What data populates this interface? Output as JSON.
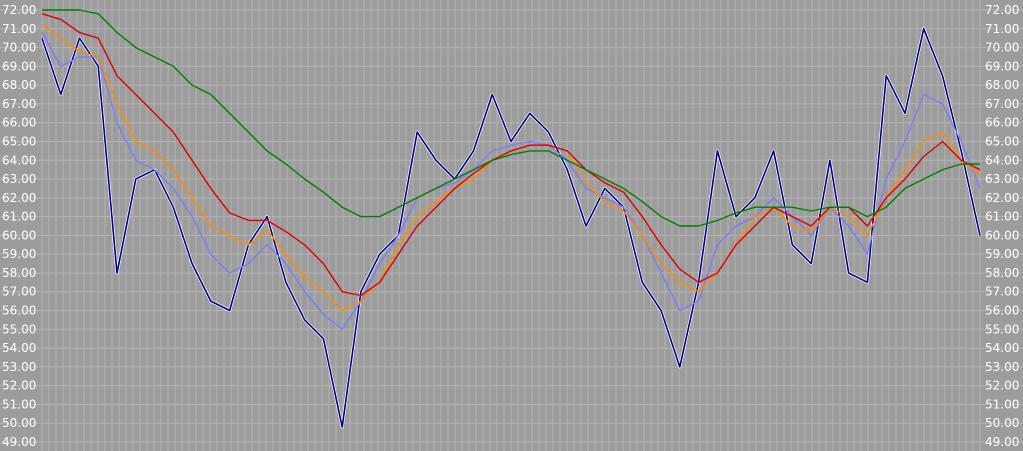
{
  "chart_data": {
    "type": "line",
    "title": "",
    "xlabel": "",
    "ylabel": "",
    "ylim": [
      49,
      72
    ],
    "grid": true,
    "y_ticks": [
      "72.00",
      "71.00",
      "70.00",
      "69.00",
      "68.00",
      "67.00",
      "66.00",
      "65.00",
      "64.00",
      "63.00",
      "62.00",
      "61.00",
      "60.00",
      "59.00",
      "58.00",
      "57.00",
      "56.00",
      "55.00",
      "54.00",
      "53.00",
      "52.00",
      "51.00",
      "50.00",
      "49.00"
    ],
    "y_tick_values": [
      72,
      71,
      70,
      69,
      68,
      67,
      66,
      65,
      64,
      63,
      62,
      61,
      60,
      59,
      58,
      57,
      56,
      55,
      54,
      53,
      52,
      51,
      50,
      49
    ],
    "x": [
      0,
      10,
      20,
      30,
      40,
      50,
      60,
      70,
      80,
      90,
      100,
      110,
      120,
      130,
      140,
      150,
      160,
      170,
      180,
      190,
      200,
      210,
      220,
      230,
      240,
      250,
      260,
      270,
      280,
      290,
      300,
      310,
      320,
      330,
      340,
      350,
      360,
      370,
      380,
      390,
      400,
      410,
      420,
      430,
      440,
      450,
      460,
      470,
      480,
      490,
      500
    ],
    "series": [
      {
        "color": "#000080",
        "values": [
          70.5,
          67.5,
          70.5,
          69.0,
          58.0,
          63.0,
          63.5,
          61.5,
          58.5,
          56.5,
          56.0,
          59.5,
          61.0,
          57.5,
          55.5,
          54.5,
          49.8,
          57.0,
          59.0,
          60.0,
          65.5,
          64.0,
          63.0,
          64.5,
          67.5,
          65.0,
          66.5,
          65.5,
          63.5,
          60.5,
          62.5,
          61.5,
          57.5,
          56.0,
          53.0,
          57.5,
          64.5,
          61.0,
          62.0,
          64.5,
          59.5,
          58.5,
          64.0,
          58.0,
          57.5,
          68.5,
          66.5,
          71.0,
          68.5,
          64.5,
          60.0
        ]
      },
      {
        "color": "#7c7cfc",
        "values": [
          70.8,
          69.0,
          69.5,
          69.5,
          66.0,
          64.0,
          63.5,
          62.5,
          61.0,
          59.0,
          58.0,
          58.5,
          59.5,
          58.5,
          57.0,
          55.8,
          55.0,
          56.5,
          58.5,
          60.0,
          62.0,
          62.5,
          62.8,
          63.5,
          64.5,
          64.8,
          65.0,
          64.8,
          64.0,
          62.5,
          62.0,
          61.5,
          60.0,
          58.0,
          56.0,
          56.5,
          59.5,
          60.5,
          61.0,
          62.0,
          61.0,
          60.0,
          61.5,
          60.5,
          59.0,
          63.0,
          65.0,
          67.5,
          67.0,
          65.0,
          62.5
        ]
      },
      {
        "color": "#ff8c00",
        "values": [
          71.2,
          70.5,
          69.8,
          69.5,
          67.0,
          65.0,
          64.5,
          63.5,
          62.0,
          60.5,
          60.0,
          59.5,
          60.3,
          59.0,
          57.8,
          57.0,
          56.0,
          56.5,
          57.5,
          59.5,
          61.0,
          61.8,
          62.5,
          63.0,
          64.0,
          64.5,
          64.8,
          64.8,
          64.5,
          62.8,
          61.8,
          61.3,
          60.0,
          58.5,
          57.5,
          57.0,
          58.0,
          59.5,
          61.0,
          61.5,
          60.5,
          60.2,
          61.5,
          61.0,
          60.0,
          62.0,
          63.5,
          65.0,
          65.5,
          64.0,
          63.2
        ]
      },
      {
        "color": "#e00000",
        "values": [
          71.8,
          71.5,
          70.8,
          70.5,
          68.5,
          67.5,
          66.5,
          65.5,
          64.0,
          62.5,
          61.2,
          60.8,
          60.8,
          60.2,
          59.5,
          58.5,
          57.0,
          56.8,
          57.5,
          59.0,
          60.5,
          61.5,
          62.5,
          63.3,
          64.0,
          64.5,
          64.8,
          64.8,
          64.5,
          63.5,
          62.8,
          62.3,
          61.0,
          59.5,
          58.2,
          57.5,
          58.0,
          59.5,
          60.5,
          61.5,
          61.0,
          60.5,
          61.5,
          61.5,
          60.5,
          62.0,
          63.0,
          64.2,
          65.0,
          64.0,
          63.5
        ]
      },
      {
        "color": "#008000",
        "values": [
          72.0,
          72.0,
          72.0,
          71.8,
          70.8,
          70.0,
          69.5,
          69.0,
          68.0,
          67.5,
          66.5,
          65.5,
          64.5,
          63.8,
          63.0,
          62.3,
          61.5,
          61.0,
          61.0,
          61.5,
          62.0,
          62.5,
          63.0,
          63.5,
          64.0,
          64.3,
          64.5,
          64.5,
          64.0,
          63.5,
          63.0,
          62.5,
          61.8,
          61.0,
          60.5,
          60.5,
          60.8,
          61.2,
          61.5,
          61.5,
          61.5,
          61.3,
          61.5,
          61.5,
          61.0,
          61.5,
          62.5,
          63.0,
          63.5,
          63.8,
          63.8
        ]
      }
    ]
  }
}
